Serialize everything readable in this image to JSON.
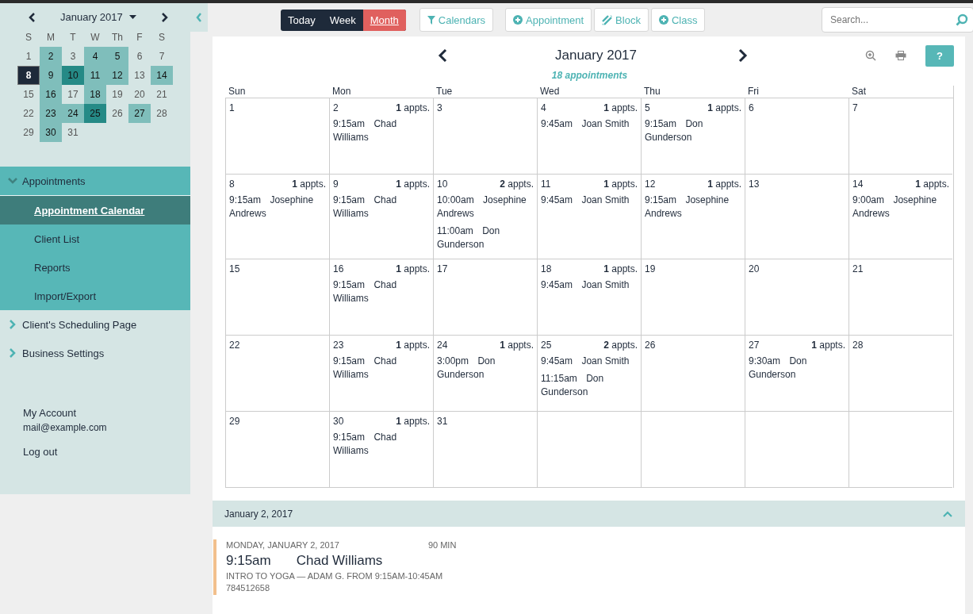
{
  "mini_calendar": {
    "title": "January 2017",
    "weekdays": [
      "S",
      "M",
      "T",
      "W",
      "Th",
      "F",
      "S"
    ],
    "days": [
      {
        "label": "1",
        "kind": "plain"
      },
      {
        "label": "2",
        "kind": "booked"
      },
      {
        "label": "3",
        "kind": "plain"
      },
      {
        "label": "4",
        "kind": "booked"
      },
      {
        "label": "5",
        "kind": "booked"
      },
      {
        "label": "6",
        "kind": "plain"
      },
      {
        "label": "7",
        "kind": "plain"
      },
      {
        "label": "8",
        "kind": "today"
      },
      {
        "label": "9",
        "kind": "booked"
      },
      {
        "label": "10",
        "kind": "busy"
      },
      {
        "label": "11",
        "kind": "booked"
      },
      {
        "label": "12",
        "kind": "booked"
      },
      {
        "label": "13",
        "kind": "plain"
      },
      {
        "label": "14",
        "kind": "booked"
      },
      {
        "label": "15",
        "kind": "plain"
      },
      {
        "label": "16",
        "kind": "booked"
      },
      {
        "label": "17",
        "kind": "plain"
      },
      {
        "label": "18",
        "kind": "booked"
      },
      {
        "label": "19",
        "kind": "plain"
      },
      {
        "label": "20",
        "kind": "plain"
      },
      {
        "label": "21",
        "kind": "plain"
      },
      {
        "label": "22",
        "kind": "plain"
      },
      {
        "label": "23",
        "kind": "booked"
      },
      {
        "label": "24",
        "kind": "booked"
      },
      {
        "label": "25",
        "kind": "busy"
      },
      {
        "label": "26",
        "kind": "plain"
      },
      {
        "label": "27",
        "kind": "booked"
      },
      {
        "label": "28",
        "kind": "plain"
      },
      {
        "label": "29",
        "kind": "plain"
      },
      {
        "label": "30",
        "kind": "booked"
      },
      {
        "label": "31",
        "kind": "plain"
      }
    ]
  },
  "sidebar": {
    "items": [
      {
        "label": "Appointments",
        "expanded": true,
        "children": [
          {
            "label": "Appointment Calendar",
            "selected": true
          },
          {
            "label": "Client List",
            "selected": false
          },
          {
            "label": "Reports",
            "selected": false
          },
          {
            "label": "Import/Export",
            "selected": false
          }
        ]
      },
      {
        "label": "Client's Scheduling Page",
        "expanded": false
      },
      {
        "label": "Business Settings",
        "expanded": false
      }
    ],
    "account": {
      "label": "My Account",
      "email": "mail@example.com",
      "logout": "Log out"
    }
  },
  "toolbar": {
    "views": [
      {
        "label": "Today",
        "selected": false
      },
      {
        "label": "Week",
        "selected": false
      },
      {
        "label": "Month",
        "selected": true
      }
    ],
    "buttons": [
      {
        "label": "Calendars",
        "kind": "filter"
      },
      {
        "label": "Appointment",
        "kind": "add"
      },
      {
        "label": "Block",
        "kind": "block"
      },
      {
        "label": "Class",
        "kind": "add"
      }
    ],
    "search": {
      "placeholder": "Search..."
    }
  },
  "calendar": {
    "title": "January 2017",
    "summary": "18 appointments",
    "help": "?",
    "weekdays": [
      "Sun",
      "Mon",
      "Tue",
      "Wed",
      "Thu",
      "Fri",
      "Sat"
    ],
    "weeks": [
      [
        {
          "date": "1"
        },
        {
          "date": "2",
          "count": "**1** appts.",
          "appointments": [
            {
              "time": "9:15am",
              "name": "Chad Williams"
            }
          ]
        },
        {
          "date": "3"
        },
        {
          "date": "4",
          "count": "**1** appts.",
          "appointments": [
            {
              "time": "9:45am",
              "name": "Joan Smith"
            }
          ]
        },
        {
          "date": "5",
          "count": "**1** appts.",
          "appointments": [
            {
              "time": "9:15am",
              "name": "Don Gunderson"
            }
          ]
        },
        {
          "date": "6"
        },
        {
          "date": "7"
        }
      ],
      [
        {
          "date": "8",
          "count": "**1** appts.",
          "appointments": [
            {
              "time": "9:15am",
              "name": "Josephine Andrews"
            }
          ]
        },
        {
          "date": "9",
          "count": "**1** appts.",
          "appointments": [
            {
              "time": "9:15am",
              "name": "Chad Williams"
            }
          ]
        },
        {
          "date": "10",
          "count": "**2** appts.",
          "appointments": [
            {
              "time": "10:00am",
              "name": "Josephine Andrews"
            },
            {
              "time": "11:00am",
              "name": "Don Gunderson"
            }
          ]
        },
        {
          "date": "11",
          "count": "**1** appts.",
          "appointments": [
            {
              "time": "9:45am",
              "name": "Joan Smith"
            }
          ]
        },
        {
          "date": "12",
          "count": "**1** appts.",
          "appointments": [
            {
              "time": "9:15am",
              "name": "Josephine Andrews"
            }
          ]
        },
        {
          "date": "13"
        },
        {
          "date": "14",
          "count": "**1** appts.",
          "appointments": [
            {
              "time": "9:00am",
              "name": "Josephine Andrews"
            }
          ]
        }
      ],
      [
        {
          "date": "15"
        },
        {
          "date": "16",
          "count": "**1** appts.",
          "appointments": [
            {
              "time": "9:15am",
              "name": "Chad Williams"
            }
          ]
        },
        {
          "date": "17"
        },
        {
          "date": "18",
          "count": "**1** appts.",
          "appointments": [
            {
              "time": "9:45am",
              "name": "Joan Smith"
            }
          ]
        },
        {
          "date": "19"
        },
        {
          "date": "20"
        },
        {
          "date": "21"
        }
      ],
      [
        {
          "date": "22"
        },
        {
          "date": "23",
          "count": "**1** appts.",
          "appointments": [
            {
              "time": "9:15am",
              "name": "Chad Williams"
            }
          ]
        },
        {
          "date": "24",
          "count": "**1** appts.",
          "appointments": [
            {
              "time": "3:00pm",
              "name": "Don Gunderson"
            }
          ]
        },
        {
          "date": "25",
          "count": "**2** appts.",
          "appointments": [
            {
              "time": "9:45am",
              "name": "Joan Smith"
            },
            {
              "time": "11:15am",
              "name": "Don Gunderson"
            }
          ]
        },
        {
          "date": "26"
        },
        {
          "date": "27",
          "count": "**1** appts.",
          "appointments": [
            {
              "time": "9:30am",
              "name": "Don Gunderson"
            }
          ]
        },
        {
          "date": "28"
        }
      ],
      [
        {
          "date": "29"
        },
        {
          "date": "30",
          "count": "**1** appts.",
          "appointments": [
            {
              "time": "9:15am",
              "name": "Chad Williams"
            }
          ]
        },
        {
          "date": "31"
        }
      ]
    ]
  },
  "details": {
    "heading": "January 2, 2017",
    "expanded": true,
    "entry": {
      "day": "MONDAY, JANUARY 2, 2017",
      "duration": "90 MIN",
      "time": "9:15am",
      "name": "Chad Williams",
      "description": "INTRO TO YOGA — ADAM G. FROM 9:15AM-10:45AM",
      "phone": "784512658"
    }
  }
}
